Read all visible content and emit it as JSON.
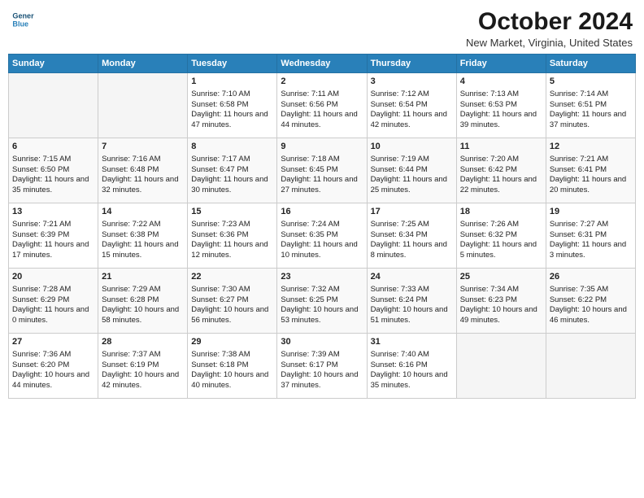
{
  "header": {
    "logo_line1": "General",
    "logo_line2": "Blue",
    "month": "October 2024",
    "location": "New Market, Virginia, United States"
  },
  "weekdays": [
    "Sunday",
    "Monday",
    "Tuesday",
    "Wednesday",
    "Thursday",
    "Friday",
    "Saturday"
  ],
  "weeks": [
    [
      {
        "day": "",
        "empty": true
      },
      {
        "day": "",
        "empty": true
      },
      {
        "day": "1",
        "info": "Sunrise: 7:10 AM\nSunset: 6:58 PM\nDaylight: 11 hours and 47 minutes."
      },
      {
        "day": "2",
        "info": "Sunrise: 7:11 AM\nSunset: 6:56 PM\nDaylight: 11 hours and 44 minutes."
      },
      {
        "day": "3",
        "info": "Sunrise: 7:12 AM\nSunset: 6:54 PM\nDaylight: 11 hours and 42 minutes."
      },
      {
        "day": "4",
        "info": "Sunrise: 7:13 AM\nSunset: 6:53 PM\nDaylight: 11 hours and 39 minutes."
      },
      {
        "day": "5",
        "info": "Sunrise: 7:14 AM\nSunset: 6:51 PM\nDaylight: 11 hours and 37 minutes."
      }
    ],
    [
      {
        "day": "6",
        "info": "Sunrise: 7:15 AM\nSunset: 6:50 PM\nDaylight: 11 hours and 35 minutes."
      },
      {
        "day": "7",
        "info": "Sunrise: 7:16 AM\nSunset: 6:48 PM\nDaylight: 11 hours and 32 minutes."
      },
      {
        "day": "8",
        "info": "Sunrise: 7:17 AM\nSunset: 6:47 PM\nDaylight: 11 hours and 30 minutes."
      },
      {
        "day": "9",
        "info": "Sunrise: 7:18 AM\nSunset: 6:45 PM\nDaylight: 11 hours and 27 minutes."
      },
      {
        "day": "10",
        "info": "Sunrise: 7:19 AM\nSunset: 6:44 PM\nDaylight: 11 hours and 25 minutes."
      },
      {
        "day": "11",
        "info": "Sunrise: 7:20 AM\nSunset: 6:42 PM\nDaylight: 11 hours and 22 minutes."
      },
      {
        "day": "12",
        "info": "Sunrise: 7:21 AM\nSunset: 6:41 PM\nDaylight: 11 hours and 20 minutes."
      }
    ],
    [
      {
        "day": "13",
        "info": "Sunrise: 7:21 AM\nSunset: 6:39 PM\nDaylight: 11 hours and 17 minutes."
      },
      {
        "day": "14",
        "info": "Sunrise: 7:22 AM\nSunset: 6:38 PM\nDaylight: 11 hours and 15 minutes."
      },
      {
        "day": "15",
        "info": "Sunrise: 7:23 AM\nSunset: 6:36 PM\nDaylight: 11 hours and 12 minutes."
      },
      {
        "day": "16",
        "info": "Sunrise: 7:24 AM\nSunset: 6:35 PM\nDaylight: 11 hours and 10 minutes."
      },
      {
        "day": "17",
        "info": "Sunrise: 7:25 AM\nSunset: 6:34 PM\nDaylight: 11 hours and 8 minutes."
      },
      {
        "day": "18",
        "info": "Sunrise: 7:26 AM\nSunset: 6:32 PM\nDaylight: 11 hours and 5 minutes."
      },
      {
        "day": "19",
        "info": "Sunrise: 7:27 AM\nSunset: 6:31 PM\nDaylight: 11 hours and 3 minutes."
      }
    ],
    [
      {
        "day": "20",
        "info": "Sunrise: 7:28 AM\nSunset: 6:29 PM\nDaylight: 11 hours and 0 minutes."
      },
      {
        "day": "21",
        "info": "Sunrise: 7:29 AM\nSunset: 6:28 PM\nDaylight: 10 hours and 58 minutes."
      },
      {
        "day": "22",
        "info": "Sunrise: 7:30 AM\nSunset: 6:27 PM\nDaylight: 10 hours and 56 minutes."
      },
      {
        "day": "23",
        "info": "Sunrise: 7:32 AM\nSunset: 6:25 PM\nDaylight: 10 hours and 53 minutes."
      },
      {
        "day": "24",
        "info": "Sunrise: 7:33 AM\nSunset: 6:24 PM\nDaylight: 10 hours and 51 minutes."
      },
      {
        "day": "25",
        "info": "Sunrise: 7:34 AM\nSunset: 6:23 PM\nDaylight: 10 hours and 49 minutes."
      },
      {
        "day": "26",
        "info": "Sunrise: 7:35 AM\nSunset: 6:22 PM\nDaylight: 10 hours and 46 minutes."
      }
    ],
    [
      {
        "day": "27",
        "info": "Sunrise: 7:36 AM\nSunset: 6:20 PM\nDaylight: 10 hours and 44 minutes."
      },
      {
        "day": "28",
        "info": "Sunrise: 7:37 AM\nSunset: 6:19 PM\nDaylight: 10 hours and 42 minutes."
      },
      {
        "day": "29",
        "info": "Sunrise: 7:38 AM\nSunset: 6:18 PM\nDaylight: 10 hours and 40 minutes."
      },
      {
        "day": "30",
        "info": "Sunrise: 7:39 AM\nSunset: 6:17 PM\nDaylight: 10 hours and 37 minutes."
      },
      {
        "day": "31",
        "info": "Sunrise: 7:40 AM\nSunset: 6:16 PM\nDaylight: 10 hours and 35 minutes."
      },
      {
        "day": "",
        "empty": true
      },
      {
        "day": "",
        "empty": true
      }
    ]
  ]
}
